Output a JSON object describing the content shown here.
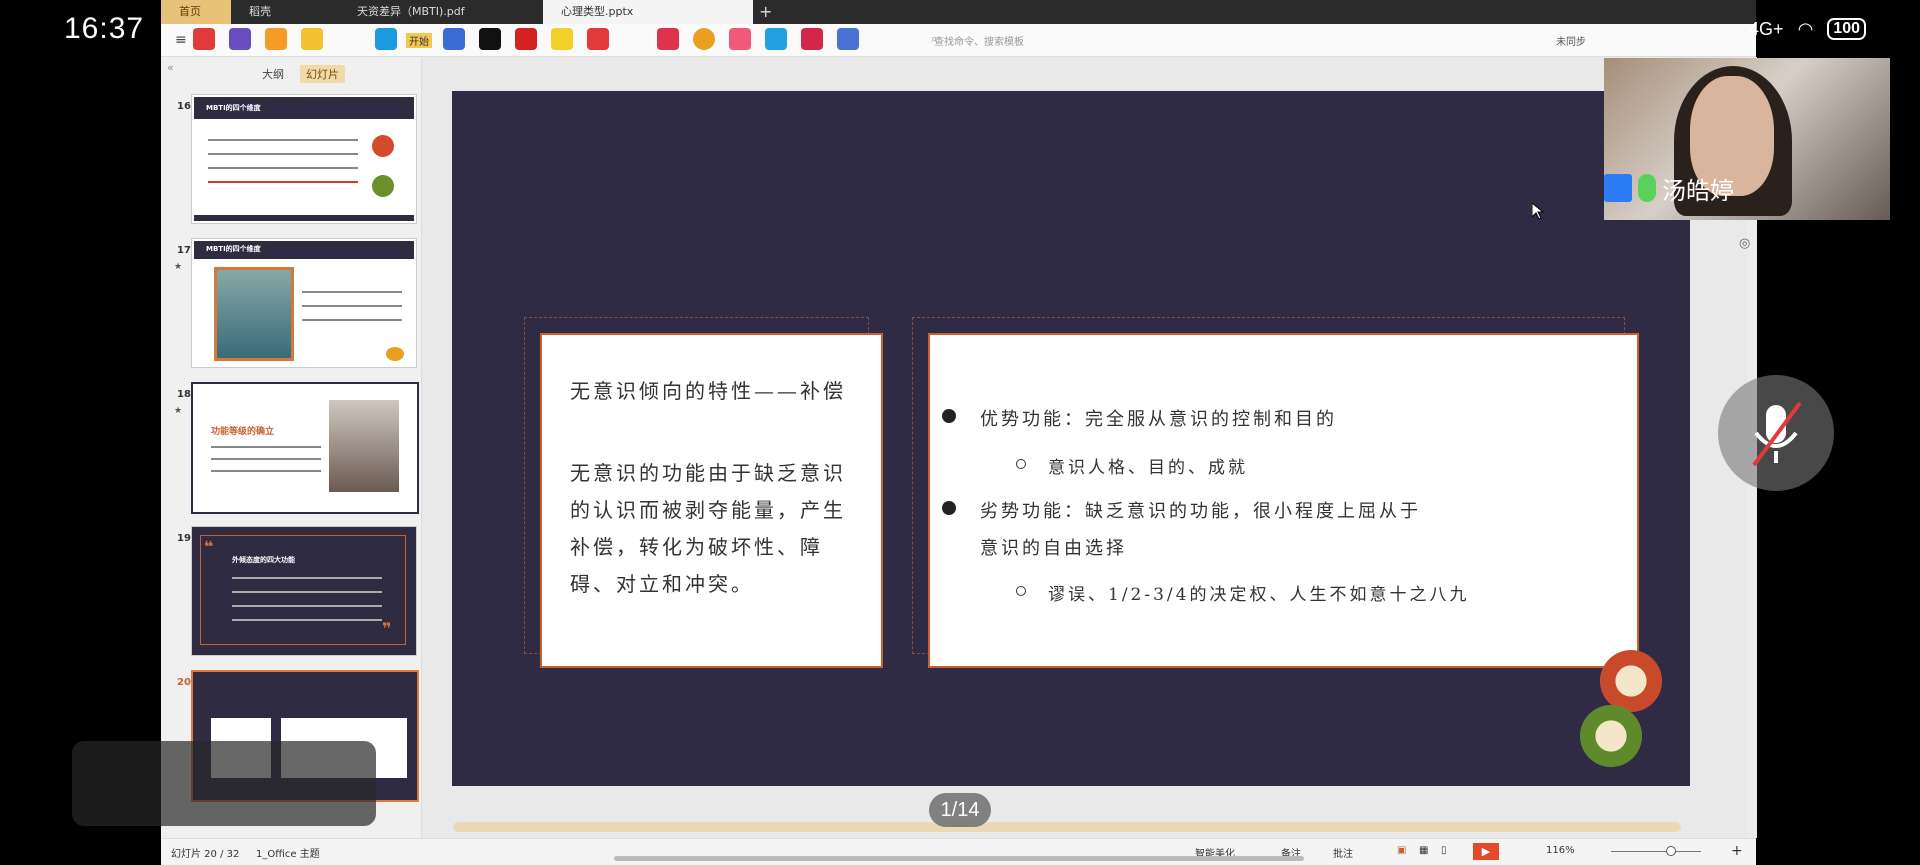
{
  "phone_status": {
    "time": "16:37",
    "battery": "100",
    "network": "4G+"
  },
  "tabs": [
    {
      "label": "首页"
    },
    {
      "label": "稻壳"
    },
    {
      "label": "天资差异（MBTI).pdf"
    },
    {
      "label": "心理类型.pptx"
    }
  ],
  "toolbar": {
    "start_label": "开始",
    "search_placeholder": "查找命令、搜索模板",
    "unsync_label": "未同步"
  },
  "left_panel": {
    "view_tabs": [
      "大纲",
      "幻灯片"
    ],
    "thumbnails": [
      {
        "num": "16",
        "title": "MBTI的四个维度"
      },
      {
        "num": "17",
        "title": "MBTI的四个维度"
      },
      {
        "num": "18",
        "title": "功能等级的确立"
      },
      {
        "num": "19",
        "title": "外倾态度的四大功能"
      },
      {
        "num": "20",
        "title": ""
      }
    ]
  },
  "slide": {
    "card1": {
      "title": "无意识倾向的特性——补偿",
      "body": "无意识的功能由于缺乏意识的认识而被剥夺能量，产生补偿，转化为破坏性、障碍、对立和冲突。"
    },
    "card2": {
      "bullet1": "优势功能：完全服从意识的控制和目的",
      "sub1": "意识人格、目的、成就",
      "bullet2a": "劣势功能：缺乏意识的功能，很小程度上屈从于",
      "bullet2b": "意识的自由选择",
      "sub2": "谬误、1/2-3/4的决定权、人生不如意十之八九"
    }
  },
  "statusbar": {
    "slide_info": "幻灯片 20 / 32",
    "theme": "1_Office 主题",
    "smart": "智能美化",
    "notes": "备注",
    "comment": "批注",
    "zoom": "116%"
  },
  "video": {
    "participant_name": "汤皓婷"
  },
  "page_counter": "1/14",
  "colors": {
    "slide_bg": "#2f2b45",
    "card_border": "#c9602f",
    "accent_tab": "#e9c27a"
  }
}
